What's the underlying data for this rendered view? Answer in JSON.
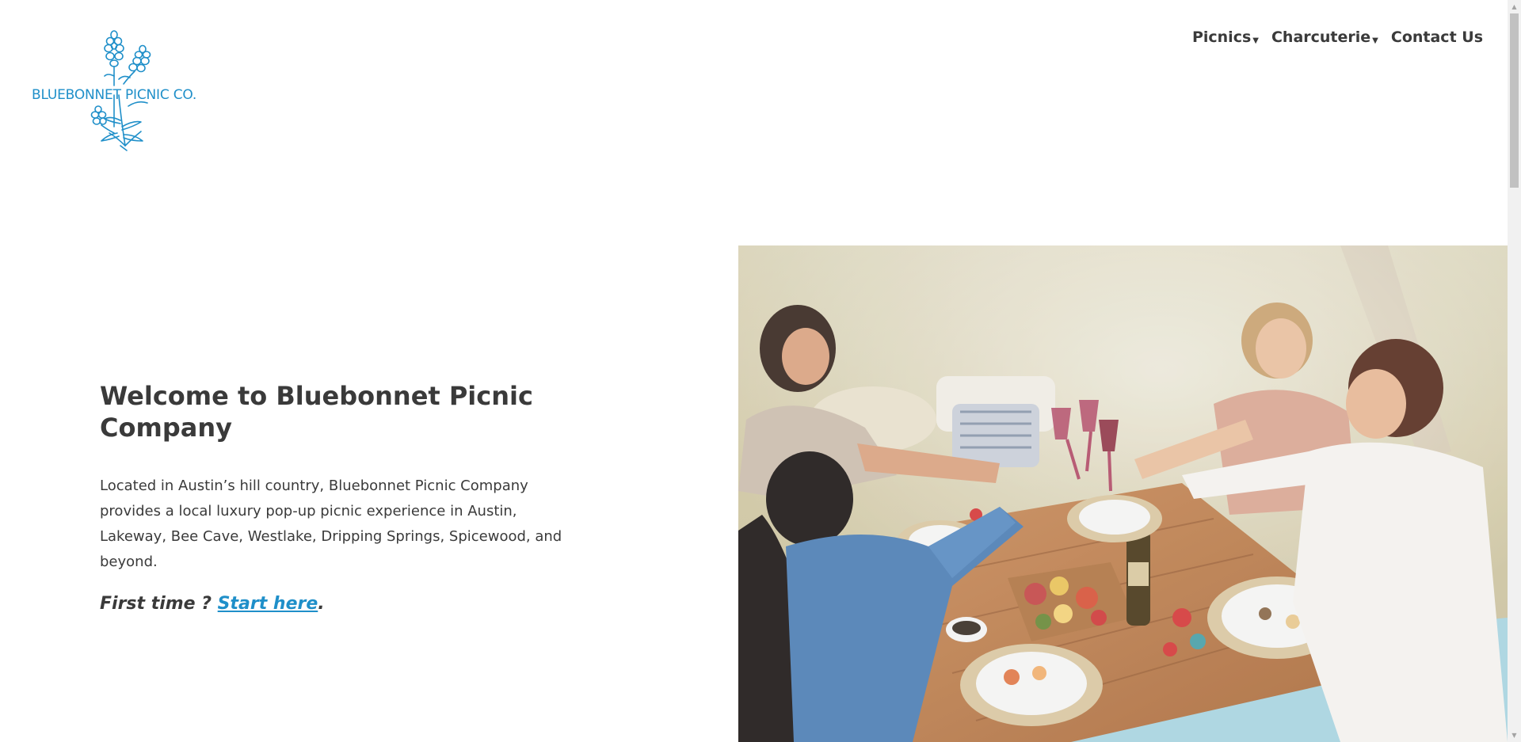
{
  "brand": {
    "logo_text": "BLUEBONNET PICNIC CO.",
    "logo_icon": "bluebonnet-flower-icon",
    "accent_color": "#1f8fc9"
  },
  "nav": {
    "items": [
      {
        "label": "Picnics",
        "has_dropdown": true
      },
      {
        "label": "Charcuterie",
        "has_dropdown": true
      },
      {
        "label": "Contact Us",
        "has_dropdown": false
      }
    ],
    "caret": "▼"
  },
  "hero": {
    "title": "Welcome to Bluebonnet Picnic Company",
    "description": "Located in Austin’s hill country, Bluebonnet Picnic Company provides a local luxury pop-up picnic experience in Austin, Lakeway, Bee Cave, Westlake, Dripping Springs, Spicewood, and beyond.",
    "first_time_prefix": "First time ? ",
    "start_link": "Start here",
    "first_time_suffix": "."
  },
  "scrollbar": {
    "up_arrow": "▲",
    "down_arrow": "▼"
  }
}
